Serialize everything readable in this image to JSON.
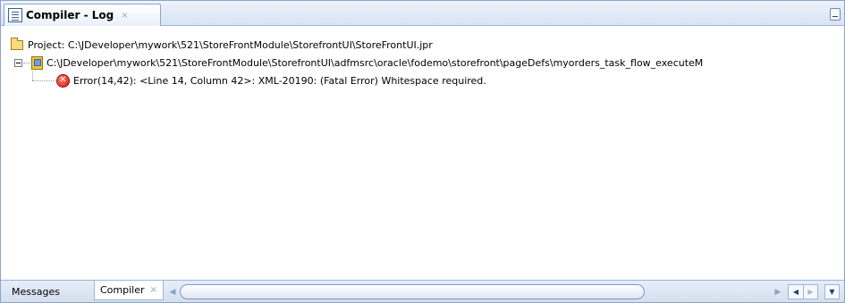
{
  "window": {
    "title": "Compiler - Log",
    "title_close": "×",
    "minimize_icon": "minimize-icon",
    "icon": "log-icon"
  },
  "tree": {
    "project": {
      "label": "Project: C:\\JDeveloper\\mywork\\521\\StoreFrontModule\\StorefrontUI\\StoreFrontUI.jpr",
      "icon": "folder-icon"
    },
    "file": {
      "label": "C:\\JDeveloper\\mywork\\521\\StoreFrontModule\\StorefrontUI\\adfmsrc\\oracle\\fodemo\\storefront\\pageDefs\\myorders_task_flow_executeM",
      "icon": "page-definition-file-icon",
      "expanded": true
    },
    "error": {
      "label": "Error(14,42): <Line 14, Column 42>: XML-20190: (Fatal Error) Whitespace required.",
      "icon": "error-icon",
      "glyph": "✕"
    }
  },
  "bottom_tabs": [
    {
      "label": "Messages",
      "active": false
    },
    {
      "label": "Compiler",
      "active": true,
      "close": "×"
    }
  ],
  "colors": {
    "accent_border": "#8aa4c8",
    "error_red": "#d21d10",
    "folder_yellow": "#f6dc7e"
  }
}
